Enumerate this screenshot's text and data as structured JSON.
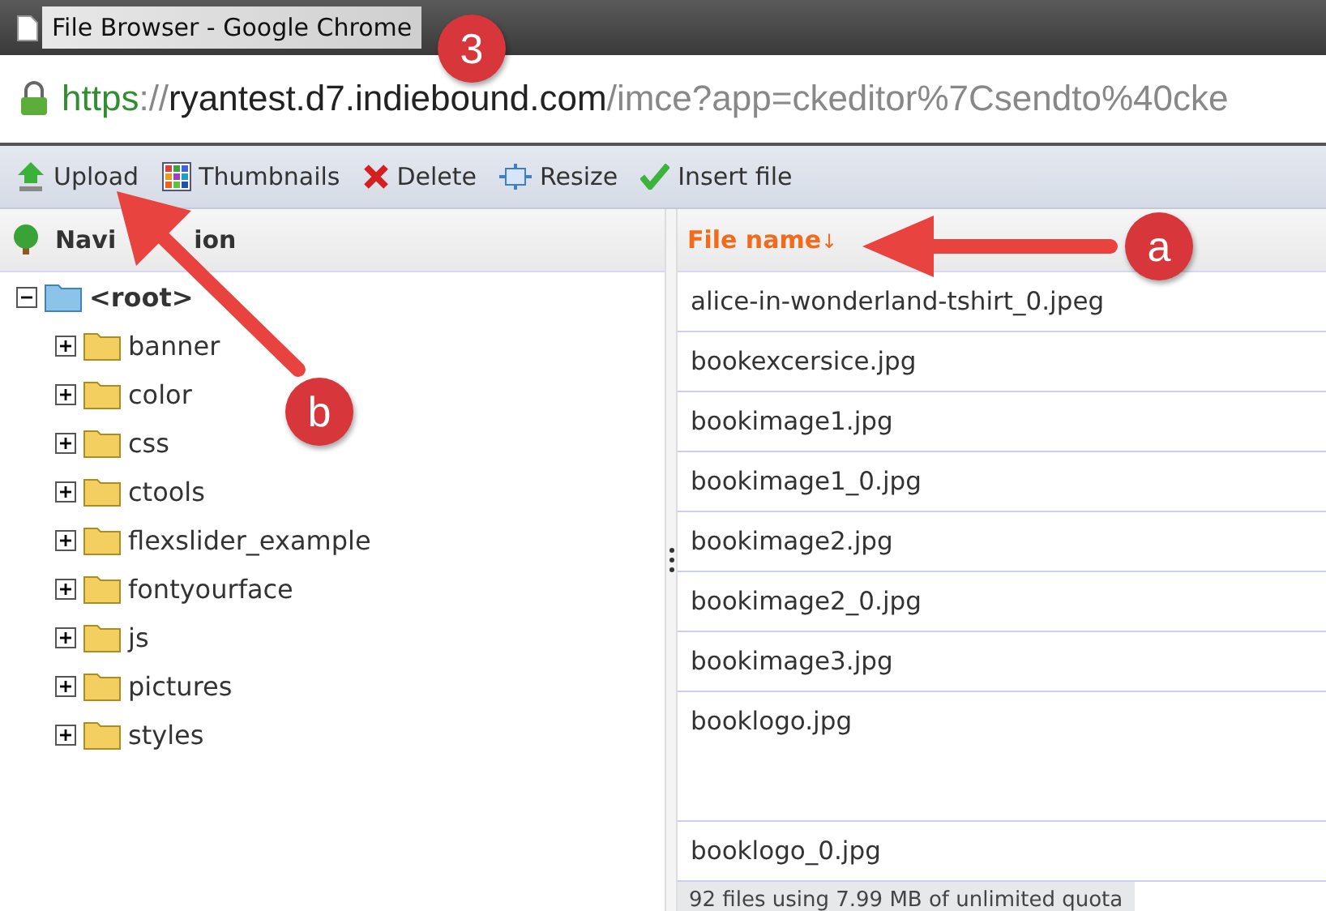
{
  "window": {
    "title": "File Browser - Google Chrome"
  },
  "address_bar": {
    "scheme": "https",
    "separator": "://",
    "host": "ryantest.d7.indiebound.com",
    "path": "/imce?app=ckeditor%7Csendto%40cke"
  },
  "toolbar": [
    {
      "kind": "upload",
      "label": "Upload"
    },
    {
      "kind": "thumbnails",
      "label": "Thumbnails"
    },
    {
      "kind": "delete",
      "label": "Delete"
    },
    {
      "kind": "resize",
      "label": "Resize"
    },
    {
      "kind": "insert",
      "label": "Insert file"
    }
  ],
  "navigation": {
    "title_parts": [
      "Navi",
      "ion"
    ],
    "tree": [
      {
        "name": "<root>",
        "expanded": true,
        "children": [
          {
            "name": "banner",
            "expanded": false
          },
          {
            "name": "color",
            "expanded": false
          },
          {
            "name": "css",
            "expanded": false
          },
          {
            "name": "ctools",
            "expanded": false
          },
          {
            "name": "flexslider_example",
            "expanded": false
          },
          {
            "name": "fontyourface",
            "expanded": false
          },
          {
            "name": "js",
            "expanded": false
          },
          {
            "name": "pictures",
            "expanded": false
          },
          {
            "name": "styles",
            "expanded": false
          }
        ]
      }
    ]
  },
  "file_list": {
    "column": {
      "label": "File name",
      "sort": "↓"
    },
    "rows": [
      {
        "name": "alice-in-wonderland-tshirt_0.jpeg",
        "tall": false
      },
      {
        "name": "bookexcersice.jpg",
        "tall": false
      },
      {
        "name": "bookimage1.jpg",
        "tall": false
      },
      {
        "name": "bookimage1_0.jpg",
        "tall": false
      },
      {
        "name": "bookimage2.jpg",
        "tall": false
      },
      {
        "name": "bookimage2_0.jpg",
        "tall": false
      },
      {
        "name": "bookimage3.jpg",
        "tall": false
      },
      {
        "name": "booklogo.jpg",
        "tall": true
      },
      {
        "name": "booklogo_0.jpg",
        "tall": false
      }
    ],
    "status": "92 files using 7.99 MB of unlimited quota"
  },
  "annotations": [
    {
      "label": "3",
      "kind": "badge"
    },
    {
      "label": "a",
      "kind": "arrow-left"
    },
    {
      "label": "b",
      "kind": "arrow-up-left"
    }
  ]
}
